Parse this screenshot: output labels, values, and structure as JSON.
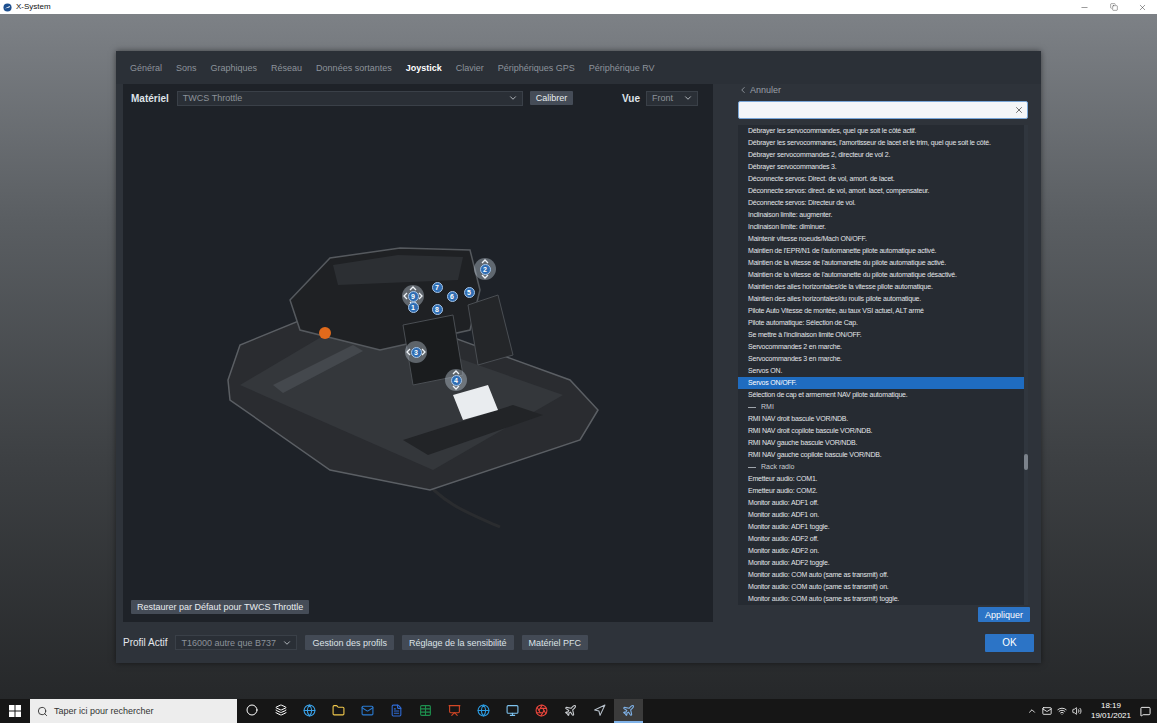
{
  "window": {
    "title": "X-System"
  },
  "settings": {
    "tabs": [
      {
        "label": "Général",
        "selected": false
      },
      {
        "label": "Sons",
        "selected": false
      },
      {
        "label": "Graphiques",
        "selected": false
      },
      {
        "label": "Réseau",
        "selected": false
      },
      {
        "label": "Données sortantes",
        "selected": false
      },
      {
        "label": "Joystick",
        "selected": true
      },
      {
        "label": "Clavier",
        "selected": false
      },
      {
        "label": "Périphériques GPS",
        "selected": false
      },
      {
        "label": "Périphérique RV",
        "selected": false
      }
    ],
    "hardware": {
      "label": "Matériel",
      "device": "TWCS Throttle",
      "calibrate": "Calibrer",
      "view_label": "Vue",
      "view": "Front"
    },
    "badges": [
      {
        "label": "9",
        "kind": "hat"
      },
      {
        "label": "1",
        "kind": "button"
      },
      {
        "label": "7",
        "kind": "button"
      },
      {
        "label": "6",
        "kind": "button"
      },
      {
        "label": "5",
        "kind": "button"
      },
      {
        "label": "2",
        "kind": "axis-vertical"
      },
      {
        "label": "8",
        "kind": "button"
      },
      {
        "label": "3",
        "kind": "axis-horizontal"
      },
      {
        "label": "4",
        "kind": "axis-vertical"
      }
    ],
    "restore_button": "Restaurer par Défaut pour TWCS Throttle",
    "commands": {
      "back": "Annuler",
      "search": {
        "value": ""
      },
      "items": [
        {
          "kind": "command",
          "label": "Débrayer les servocommandes, quel que soit le côté actif.",
          "selected": false
        },
        {
          "kind": "command",
          "label": "Débrayer les servocommanes, l'amortisseur de lacet et le trim, quel que soit le côté.",
          "selected": false
        },
        {
          "kind": "command",
          "label": "Débrayer servocommandes 2, directeur de vol 2.",
          "selected": false
        },
        {
          "kind": "command",
          "label": "Débrayer servocommandes 3.",
          "selected": false
        },
        {
          "kind": "command",
          "label": "Déconnecte servos: Direct. de vol, amort. de lacet.",
          "selected": false
        },
        {
          "kind": "command",
          "label": "Déconnecte servos: direct. de vol, amort. lacet, compensateur.",
          "selected": false
        },
        {
          "kind": "command",
          "label": "Déconnecte servos: Directeur de vol.",
          "selected": false
        },
        {
          "kind": "command",
          "label": "Inclinaison limite: augmenter.",
          "selected": false
        },
        {
          "kind": "command",
          "label": "Inclinaison limite: diminuer.",
          "selected": false
        },
        {
          "kind": "command",
          "label": "Maintenir vitesse noeuds/Mach ON/OFF.",
          "selected": false
        },
        {
          "kind": "command",
          "label": "Maintien de l'EPR/N1 de l'automanette pilote automatique activé.",
          "selected": false
        },
        {
          "kind": "command",
          "label": "Maintien de la vitesse de l'automanette du pilote automatique activé.",
          "selected": false
        },
        {
          "kind": "command",
          "label": "Maintien de la vitesse de l'automanette du pilote automatique désactivé.",
          "selected": false
        },
        {
          "kind": "command",
          "label": "Maintien des ailes horizontales/de la vitesse pilote automatique.",
          "selected": false
        },
        {
          "kind": "command",
          "label": "Maintien des ailes horizontales/du roulis pilote automatique.",
          "selected": false
        },
        {
          "kind": "command",
          "label": "Pilote Auto Vitesse de montée, au taux VSI actuel, ALT armé",
          "selected": false
        },
        {
          "kind": "command",
          "label": "Pilote automatique: Sélection de Cap.",
          "selected": false
        },
        {
          "kind": "command",
          "label": "Se mettre à l'inclinaison limite ON/OFF.",
          "selected": false
        },
        {
          "kind": "command",
          "label": "Servocommandes 2 en marche.",
          "selected": false
        },
        {
          "kind": "command",
          "label": "Servocommandes 3 en marche.",
          "selected": false
        },
        {
          "kind": "command",
          "label": "Servos ON.",
          "selected": false
        },
        {
          "kind": "command",
          "label": "Servos ON/OFF.",
          "selected": true
        },
        {
          "kind": "command",
          "label": "Sélection de cap et armement NAV pilote automatique.",
          "selected": false
        },
        {
          "kind": "header",
          "label": "RMI",
          "selected": false
        },
        {
          "kind": "command",
          "label": "RMI NAV droit bascule VOR/NDB.",
          "selected": false
        },
        {
          "kind": "command",
          "label": "RMI NAV droit copilote bascule VOR/NDB.",
          "selected": false
        },
        {
          "kind": "command",
          "label": "RMI NAV gauche bascule VOR/NDB.",
          "selected": false
        },
        {
          "kind": "command",
          "label": "RMI NAV gauche copilote bascule VOR/NDB.",
          "selected": false
        },
        {
          "kind": "header",
          "label": "Rack radio",
          "selected": false
        },
        {
          "kind": "command",
          "label": "Emetteur audio: COM1.",
          "selected": false
        },
        {
          "kind": "command",
          "label": "Emetteur audio: COM2.",
          "selected": false
        },
        {
          "kind": "command",
          "label": "Monitor audio: ADF1 off.",
          "selected": false
        },
        {
          "kind": "command",
          "label": "Monitor audio: ADF1 on.",
          "selected": false
        },
        {
          "kind": "command",
          "label": "Monitor audio: ADF1 toggle.",
          "selected": false
        },
        {
          "kind": "command",
          "label": "Monitor audio: ADF2 off.",
          "selected": false
        },
        {
          "kind": "command",
          "label": "Monitor audio: ADF2 on.",
          "selected": false
        },
        {
          "kind": "command",
          "label": "Monitor audio: ADF2 toggle.",
          "selected": false
        },
        {
          "kind": "command",
          "label": "Monitor audio: COM auto (same as transmit) off.",
          "selected": false
        },
        {
          "kind": "command",
          "label": "Monitor audio: COM auto (same as transmit) on.",
          "selected": false
        },
        {
          "kind": "command",
          "label": "Monitor audio: COM auto (same as transmit) toggle.",
          "selected": false
        }
      ],
      "scroll_position": 0.71,
      "apply": "Appliquer"
    },
    "profile": {
      "label": "Profil Actif",
      "value": "T16000 autre que B737"
    },
    "buttons": [
      "Gestion des profils",
      "Réglage de la sensibilité",
      "Matériel PFC"
    ],
    "ok": "OK"
  },
  "taskbar": {
    "search_placeholder": "Taper ici pour rechercher",
    "apps": [
      {
        "selected": false
      },
      {
        "selected": false
      },
      {
        "selected": false
      },
      {
        "selected": false
      },
      {
        "selected": false
      },
      {
        "selected": false
      },
      {
        "selected": false
      },
      {
        "selected": false
      },
      {
        "selected": false
      },
      {
        "selected": false
      },
      {
        "selected": false
      },
      {
        "selected": true
      }
    ],
    "time": "18:19",
    "date": "19/01/2021"
  }
}
